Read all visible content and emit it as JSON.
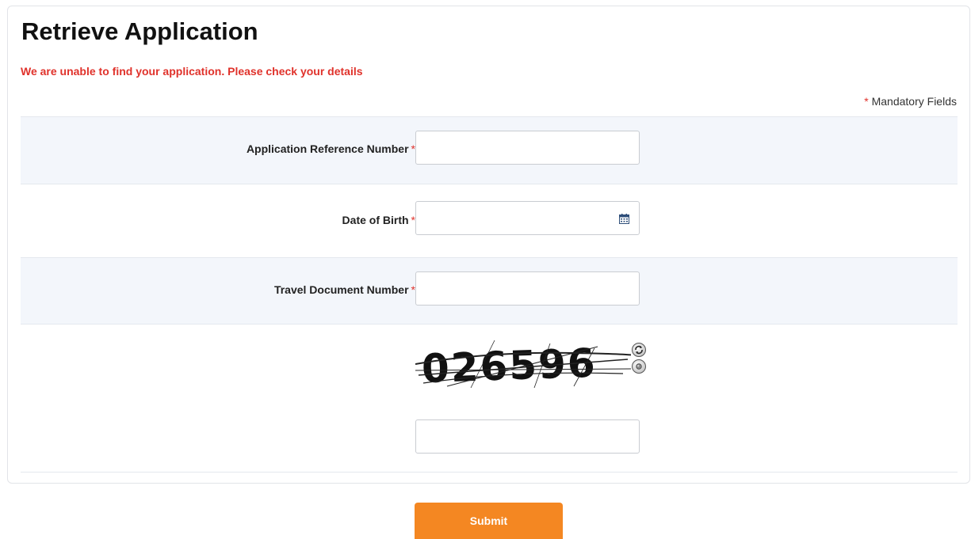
{
  "title": "Retrieve Application",
  "error_message": "We are unable to find your application. Please check your details",
  "mandatory": {
    "marker": "*",
    "text": "Mandatory Fields"
  },
  "fields": {
    "reference": {
      "label": "Application Reference Number",
      "required_marker": "*",
      "value": ""
    },
    "dob": {
      "label": "Date of Birth",
      "required_marker": "*",
      "value": "",
      "icon": "calendar-icon"
    },
    "travel_doc": {
      "label": "Travel Document Number",
      "required_marker": "*",
      "value": ""
    },
    "captcha": {
      "code": "026596",
      "value": "",
      "refresh_icon": "refresh-icon",
      "audio_icon": "audio-icon"
    }
  },
  "submit_label": "Submit",
  "colors": {
    "accent": "#f48722",
    "error": "#e0322b",
    "row_shade": "#f3f6fb"
  }
}
